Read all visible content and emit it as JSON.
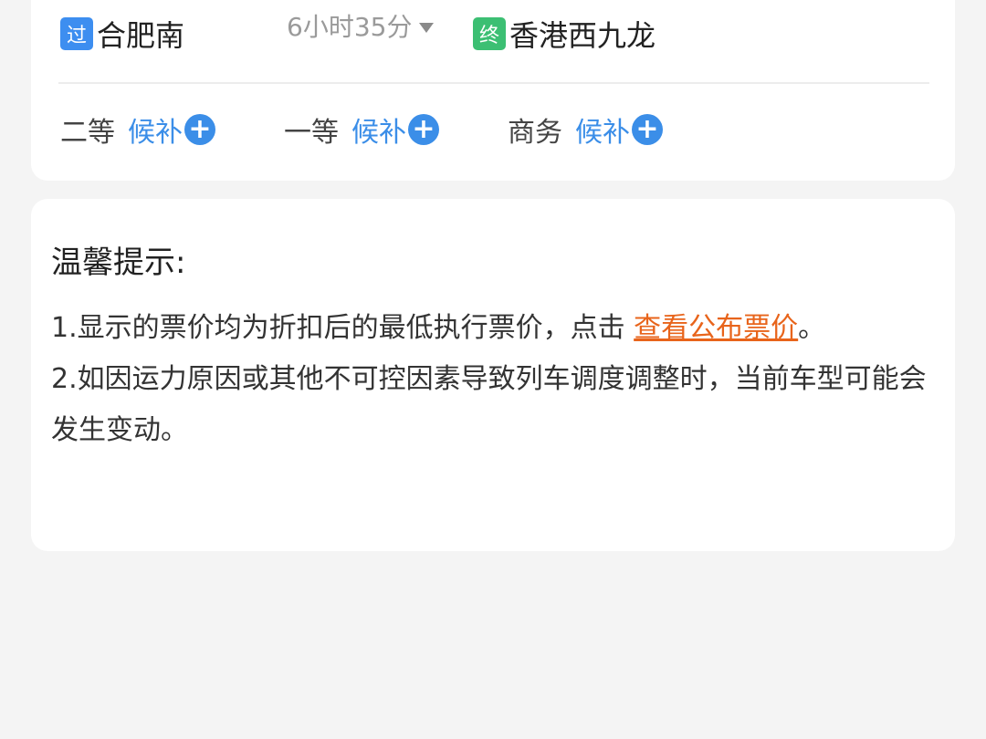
{
  "train": {
    "from": {
      "tag": "过",
      "name": "合肥南"
    },
    "duration": "6小时35分",
    "to": {
      "tag": "终",
      "name": "香港西九龙"
    },
    "seats": [
      {
        "class": "二等",
        "status": "候补"
      },
      {
        "class": "一等",
        "status": "候补"
      },
      {
        "class": "商务",
        "status": "候补"
      }
    ]
  },
  "tips": {
    "title": "温馨提示:",
    "item1_text": "1.显示的票价均为折扣后的最低执行票价，点击 ",
    "item1_link": "查看公布票价",
    "item1_end": "。",
    "item2_text": "2.如因运力原因或其他不可控因素导致列车调度调整时，当前车型可能会发生变动。"
  },
  "colors": {
    "accent_blue": "#3b8ee8",
    "link_orange": "#e8641b",
    "pass_tag": "#3d8ef0",
    "end_tag": "#3cbf73"
  },
  "icons": {
    "add": "plus-circle-icon",
    "expand": "caret-down-icon"
  }
}
